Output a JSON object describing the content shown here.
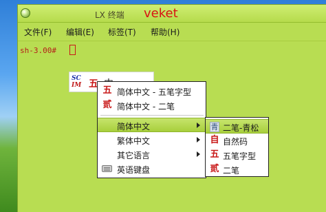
{
  "window": {
    "title": "LX 终端",
    "brand": "veket"
  },
  "menubar": {
    "items": [
      "文件(F)",
      "编辑(E)",
      "标签(T)",
      "帮助(H)"
    ]
  },
  "terminal": {
    "prompt": "sh-3.00#"
  },
  "ime_toolbar": {
    "logo_top": "SC",
    "logo_bottom": "IM",
    "mode_glyph": "五",
    "lang_glyph": "中"
  },
  "main_menu": {
    "items": [
      {
        "icon_glyph": "五",
        "label": "简体中文 - 五笔字型"
      },
      {
        "icon_glyph": "贰",
        "label": "简体中文 - 二笔"
      },
      {
        "label": "简体中文",
        "has_submenu": true,
        "active": true
      },
      {
        "label": "繁体中文",
        "has_submenu": true
      },
      {
        "label": "其它语言",
        "has_submenu": true
      },
      {
        "icon": "keyboard-icon",
        "label": "英语键盘"
      }
    ]
  },
  "sub_menu": {
    "items": [
      {
        "icon": "qing-icon",
        "icon_glyph": "青",
        "label": "二笔-青松",
        "active": true
      },
      {
        "icon_glyph": "自",
        "label": "自然码"
      },
      {
        "icon_glyph": "五",
        "label": "五笔字型"
      },
      {
        "icon_glyph": "贰",
        "label": "二笔"
      }
    ]
  },
  "colors": {
    "window_bg": "#b8dd52",
    "highlight": "#a8cf3c",
    "brand": "#d81212",
    "prompt": "#b5201a"
  }
}
